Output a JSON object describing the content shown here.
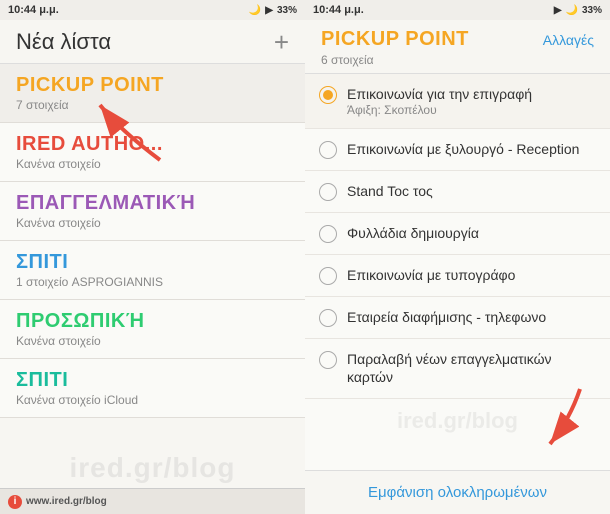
{
  "left": {
    "status_time": "10:44 μ.μ.",
    "status_battery": "33%",
    "header_title": "Νέα λίστα",
    "header_add": "+",
    "lists": [
      {
        "title": "PICKUP POINT",
        "sub": "7 στοιχεία",
        "color": "color-yellow"
      },
      {
        "title": "IRED AUTHO...",
        "sub": "Κανένα στοιχείο",
        "color": "color-red"
      },
      {
        "title": "ΕΠΑΓΓΕΛΜΑΤΙΚΉ",
        "sub": "Κανένα στοιχείο",
        "color": "color-purple"
      },
      {
        "title": "ΣΠΙΤΙ",
        "sub": "1 στοιχείο   ASPROGIANNIS",
        "color": "color-blue"
      },
      {
        "title": "ΠΡΟΣΩΠΙΚΉ",
        "sub": "Κανένα στοιχείο",
        "color": "color-green"
      },
      {
        "title": "ΣΠΙΤΙ",
        "sub": "Κανένα στοιχείο   iCloud",
        "color": "color-teal"
      }
    ],
    "watermark": "ired.gr/blog",
    "bottom_icon": "i",
    "bottom_url": "www.ired.gr/blog"
  },
  "right": {
    "status_time": "10:44 μ.μ.",
    "status_battery": "33%",
    "header_title": "PICKUP POINT",
    "header_sub": "6 στοιχεία",
    "header_action": "Αλλαγές",
    "items": [
      {
        "title": "Επικοινωνία για την επιγραφή",
        "sub": "Άφιξη: Σκοπέλου",
        "selected": true
      },
      {
        "title": "Επικοινωνία με ξυλουργό - Reception",
        "sub": "",
        "selected": false
      },
      {
        "title": "Stand Toc τος",
        "sub": "",
        "selected": false
      },
      {
        "title": "Φυλλάδια δημιουργία",
        "sub": "",
        "selected": false
      },
      {
        "title": "Επικοινωνία με τυπογράφο",
        "sub": "",
        "selected": false
      },
      {
        "title": "Εταιρεία διαφήμισης - τηλεφωνο",
        "sub": "",
        "selected": false
      },
      {
        "title": "Παραλαβή νέων επαγγελματικών καρτών",
        "sub": "",
        "selected": false
      }
    ],
    "watermark": "ired.gr/blog",
    "footer_btn": "Εμφάνιση ολοκληρωμένων"
  }
}
